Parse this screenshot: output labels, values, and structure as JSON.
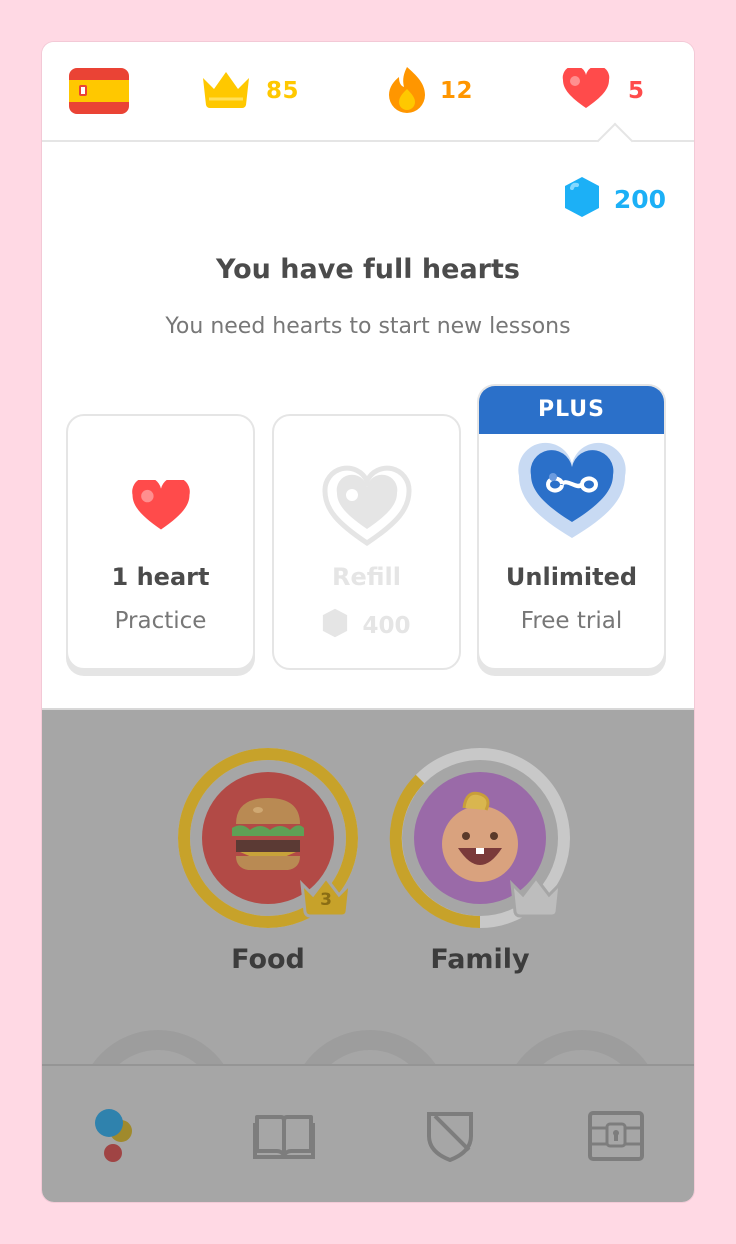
{
  "topbar": {
    "flag_icon": "spain-flag-icon",
    "crowns": "85",
    "streak": "12",
    "hearts": "5"
  },
  "panel": {
    "gems": "200",
    "title": "You have full hearts",
    "subtitle": "You need hearts to start new lessons",
    "options": [
      {
        "main": "1 heart",
        "sub": "Practice",
        "icon": "heart-icon"
      },
      {
        "main": "Refill",
        "sub": "400",
        "icon": "heart-outline-icon",
        "sub_icon": "gem-icon"
      },
      {
        "ribbon": "PLUS",
        "main": "Unlimited",
        "sub": "Free trial",
        "icon": "infinity-heart-icon"
      }
    ]
  },
  "tree": {
    "skills": [
      {
        "label": "Food",
        "level": "3",
        "icon": "burger-icon"
      },
      {
        "label": "Family",
        "icon": "baby-icon"
      }
    ]
  },
  "nav": {
    "items": [
      "learn-icon",
      "stories-icon",
      "leagues-icon",
      "shop-icon"
    ]
  },
  "colors": {
    "heart": "#ff4b4b",
    "crown": "#ffc800",
    "flame": "#ff9600",
    "gem": "#1cb0f6",
    "plus": "#2b70c9",
    "background": "#ffd9e4"
  }
}
